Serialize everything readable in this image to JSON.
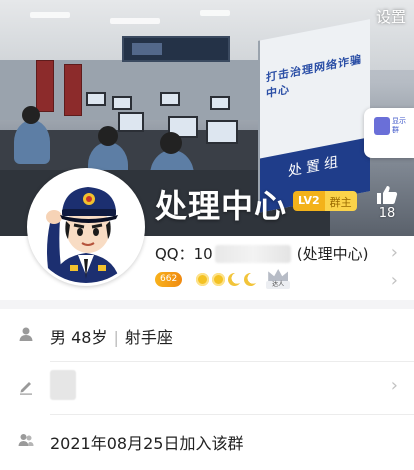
{
  "header": {
    "settings_label": "设置"
  },
  "cover": {
    "sign_text": "打击治理网络诈骗中心",
    "sign_subtext": "处置组",
    "side_tab_text": "显示 群"
  },
  "profile": {
    "name": "处理中心",
    "level_label": "LV2",
    "role_label": "群主",
    "like_count": "18",
    "qq_label": "QQ：",
    "qq_number_prefix": "10",
    "qq_suffix": "(处理中心)",
    "badge_value": "662",
    "crown_label": "达人"
  },
  "info_rows": [
    {
      "icon": "user-icon",
      "text_parts": [
        "男 48岁",
        "射手座"
      ]
    },
    {
      "icon": "pencil-icon",
      "text": ""
    },
    {
      "icon": "group-icon",
      "text": "2021年08月25日加入该群"
    }
  ],
  "colors": {
    "gold": "#f3b21a",
    "sign_blue": "#1f3d8a",
    "chevron": "#c2c2c2"
  }
}
